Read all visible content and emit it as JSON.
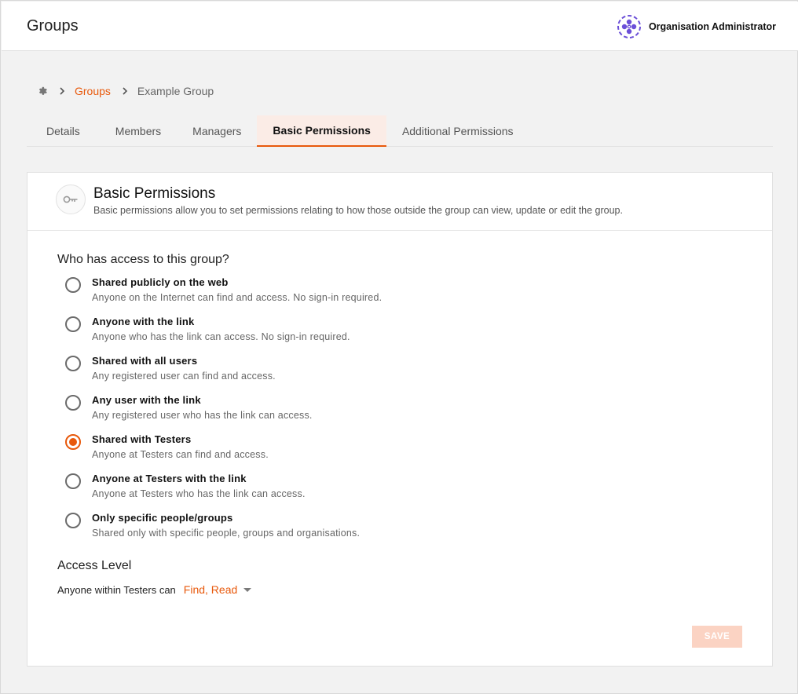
{
  "header": {
    "title": "Groups",
    "org_name": "Organisation Administrator",
    "org_logo_icon": "org-logo-icon"
  },
  "breadcrumb": {
    "root_icon": "gear-icon",
    "items": [
      {
        "label": "Groups",
        "link": true
      },
      {
        "label": "Example Group",
        "link": false
      }
    ]
  },
  "tabs": [
    {
      "label": "Details",
      "active": false
    },
    {
      "label": "Members",
      "active": false
    },
    {
      "label": "Managers",
      "active": false
    },
    {
      "label": "Basic Permissions",
      "active": true
    },
    {
      "label": "Additional Permissions",
      "active": false
    }
  ],
  "card": {
    "icon": "key-icon",
    "title": "Basic Permissions",
    "subtitle": "Basic permissions allow you to set permissions relating to how those outside the group can view, update or edit the group."
  },
  "access_question": "Who has access to this group?",
  "options": [
    {
      "label": "Shared publicly on the web",
      "desc": "Anyone on the Internet can find and access. No sign-in required.",
      "checked": false
    },
    {
      "label": "Anyone with the link",
      "desc": "Anyone who has the link can access. No sign-in required.",
      "checked": false
    },
    {
      "label": "Shared with all users",
      "desc": "Any registered user can find and access.",
      "checked": false
    },
    {
      "label": "Any user with the link",
      "desc": "Any registered user who has the link can access.",
      "checked": false
    },
    {
      "label": "Shared with Testers",
      "desc": "Anyone at Testers can find and access.",
      "checked": true
    },
    {
      "label": "Anyone at Testers with the link",
      "desc": "Anyone at Testers who has the link can access.",
      "checked": false
    },
    {
      "label": "Only specific people/groups",
      "desc": "Shared only with specific people, groups and organisations.",
      "checked": false
    }
  ],
  "access_level": {
    "title": "Access Level",
    "prefix": "Anyone within Testers can",
    "value": "Find, Read"
  },
  "save_label": "SAVE",
  "colors": {
    "accent": "#e8590c",
    "save_disabled": "#fbd3c3",
    "active_tab_bg": "#fbece6",
    "logo": "#6b4fd8"
  }
}
